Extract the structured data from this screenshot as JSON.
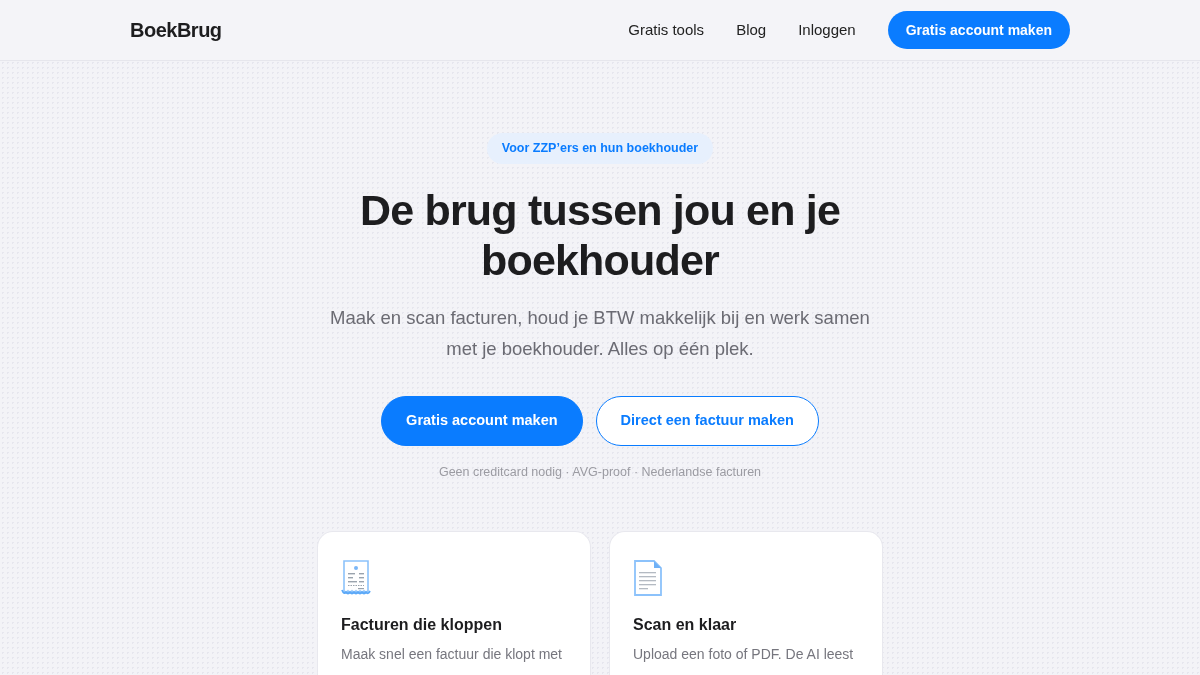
{
  "nav": {
    "logo": "BoekBrug",
    "links": [
      "Gratis tools",
      "Blog",
      "Inloggen"
    ],
    "cta": "Gratis account maken"
  },
  "hero": {
    "badge": "Voor ZZP’ers en hun boekhouder",
    "title": "De brug tussen jou en je boekhouder",
    "subtitle": "Maak en scan facturen, houd je BTW makkelijk bij en werk samen met je boekhouder. Alles op één plek.",
    "buttons": [
      {
        "label": "Gratis account maken",
        "kind": "primary"
      },
      {
        "label": "Direct een factuur maken",
        "kind": "secondary"
      }
    ],
    "note": "Geen creditcard nodig · AVG-proof · Nederlandse facturen"
  },
  "features": [
    {
      "kind": "receipt",
      "title": "Facturen die kloppen",
      "text": "Maak snel een factuur die klopt met"
    },
    {
      "kind": "document",
      "title": "Scan en klaar",
      "text": "Upload een foto of PDF. De AI leest"
    }
  ]
}
